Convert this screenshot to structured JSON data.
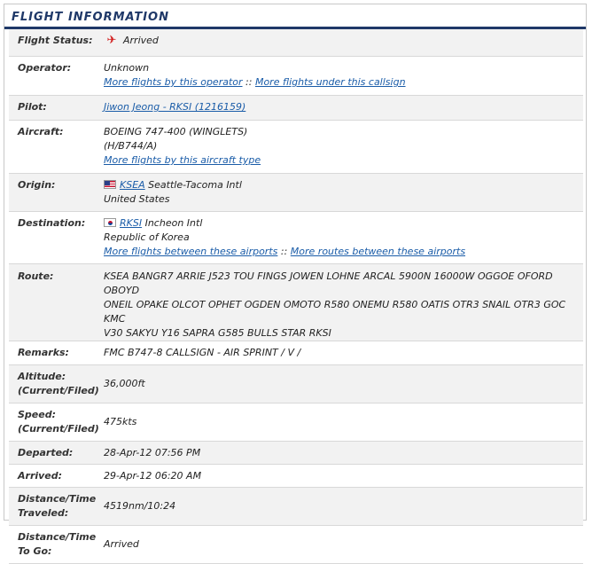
{
  "header": {
    "title": "FLIGHT INFORMATION"
  },
  "colors": {
    "accent": "#1f3868",
    "link": "#1a5ca8",
    "alert_icon": "#d21e1e"
  },
  "rows": {
    "flight_status": {
      "label": "Flight Status:",
      "icon": "airplane-status-icon",
      "value": "Arrived"
    },
    "operator": {
      "label": "Operator:",
      "value": "Unknown",
      "link1": "More flights by this operator",
      "sep": "::",
      "link2": "More flights under this callsign"
    },
    "pilot": {
      "label": "Pilot:",
      "link": "Jiwon Jeong - RKSI (1216159)"
    },
    "aircraft": {
      "label": "Aircraft:",
      "line1": "BOEING 747-400 (WINGLETS)",
      "line2": "(H/B744/A)",
      "link": "More flights by this aircraft type"
    },
    "origin": {
      "label": "Origin:",
      "flag": "us-flag-icon",
      "code": "KSEA",
      "name": "Seattle-Tacoma Intl",
      "country": "United States"
    },
    "destination": {
      "label": "Destination:",
      "flag": "kr-flag-icon",
      "code": "RKSI",
      "name": "Incheon Intl",
      "country": "Republic of Korea",
      "link1": "More flights between these airports",
      "sep": "::",
      "link2": "More routes between these airports"
    },
    "route": {
      "label": "Route:",
      "line1": "KSEA BANGR7 ARRIE J523 TOU FINGS JOWEN LOHNE ARCAL 5900N 16000W OGGOE OFORD OBOYD",
      "line2": "ONEIL OPAKE OLCOT OPHET OGDEN OMOTO R580 ONEMU R580 OATIS OTR3 SNAIL OTR3 GOC KMC",
      "line3": "V30 SAKYU Y16 SAPRA G585 BULLS STAR RKSI"
    },
    "remarks": {
      "label": "Remarks:",
      "value": "FMC B747-8 CALLSIGN - AIR SPRINT / V /"
    },
    "altitude": {
      "label_line1": "Altitude:",
      "label_line2": "(Current/Filed)",
      "value": "36,000ft"
    },
    "speed": {
      "label_line1": "Speed:",
      "label_line2": "(Current/Filed)",
      "value": "475kts"
    },
    "departed": {
      "label": "Departed:",
      "value": "28-Apr-12 07:56 PM"
    },
    "arrived": {
      "label": "Arrived:",
      "value": "29-Apr-12 06:20 AM"
    },
    "distance_traveled": {
      "label_line1": "Distance/Time",
      "label_line2": "Traveled:",
      "value": "4519nm/10:24"
    },
    "distance_to_go": {
      "label_line1": "Distance/Time",
      "label_line2": "To Go:",
      "value": "Arrived"
    }
  }
}
